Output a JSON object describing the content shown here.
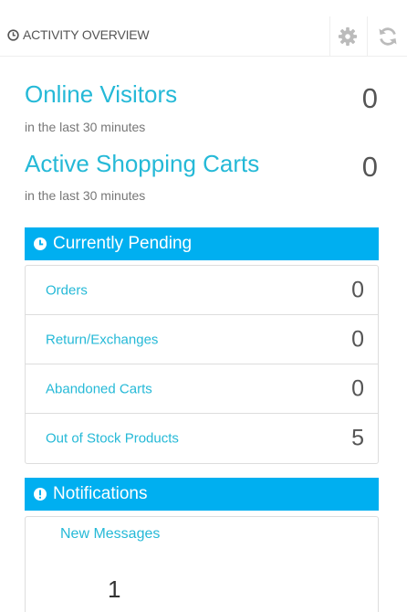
{
  "header": {
    "title": "ACTIVITY OVERVIEW",
    "title_icon": "clock-icon",
    "tools": [
      {
        "name": "configure",
        "icon": "gear-icon"
      },
      {
        "name": "refresh",
        "icon": "refresh-icon"
      }
    ]
  },
  "metrics": {
    "online_visitors": {
      "label": "Online Visitors",
      "sub": "in the last 30 minutes",
      "value": "0"
    },
    "active_carts": {
      "label": "Active Shopping Carts",
      "sub": "in the last 30 minutes",
      "value": "0"
    }
  },
  "pending": {
    "title": "Currently Pending",
    "icon": "clock-icon",
    "items": [
      {
        "label": "Orders",
        "value": "0"
      },
      {
        "label": "Return/Exchanges",
        "value": "0"
      },
      {
        "label": "Abandoned Carts",
        "value": "0"
      },
      {
        "label": "Out of Stock Products",
        "value": "5"
      }
    ]
  },
  "notifications": {
    "title": "Notifications",
    "icon": "exclamation-circle-icon",
    "items": [
      {
        "label": "New Messages",
        "value": "1"
      }
    ]
  },
  "colors": {
    "accent": "#25b9d7",
    "section_bar": "#00aff0",
    "text": "#555555"
  }
}
